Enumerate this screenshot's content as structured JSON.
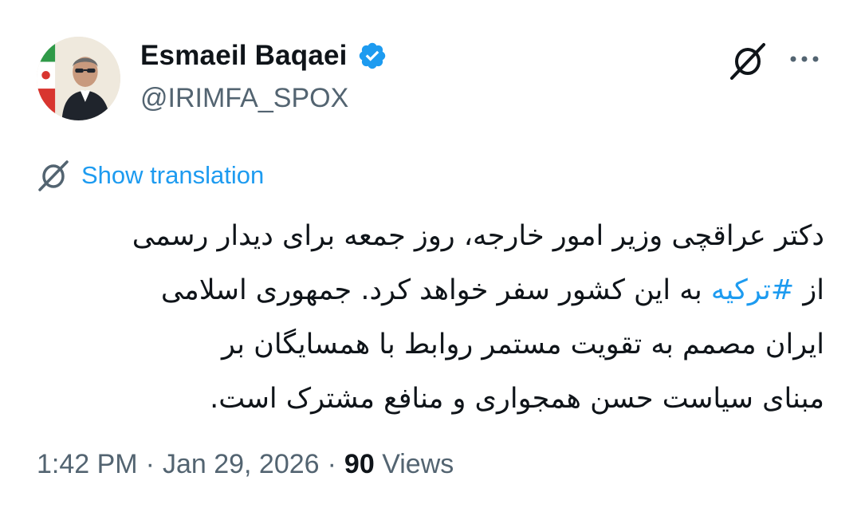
{
  "author": {
    "display_name": "Esmaeil Baqaei",
    "handle": "@IRIMFA_SPOX",
    "verified": true,
    "verified_color": "#1d9bf0"
  },
  "actions": {
    "grok_icon": "grok-icon",
    "more_icon": "more-icon"
  },
  "translation": {
    "icon": "grok-icon",
    "label": "Show translation",
    "link_color": "#1d9bf0"
  },
  "tweet": {
    "lines": [
      {
        "before": "دکتر عراقچی وزیر امور خارجه، روز جمعه برای دیدار رسمی",
        "hashtag": "",
        "after": ""
      },
      {
        "before": "از ",
        "hashtag": "#ترکیه",
        "after": " به این کشور سفر خواهد کرد. جمهوری اسلامی"
      },
      {
        "before": "ایران مصمم به تقویت مستمر روابط با همسایگان بر",
        "hashtag": "",
        "after": ""
      },
      {
        "before": "مبنای سیاست حسن همجواری و منافع مشترک است.",
        "hashtag": "",
        "after": ""
      }
    ]
  },
  "meta": {
    "time": "1:42 PM",
    "separator": "·",
    "date": "Jan 29, 2026",
    "views_count": "90",
    "views_label": "Views"
  }
}
